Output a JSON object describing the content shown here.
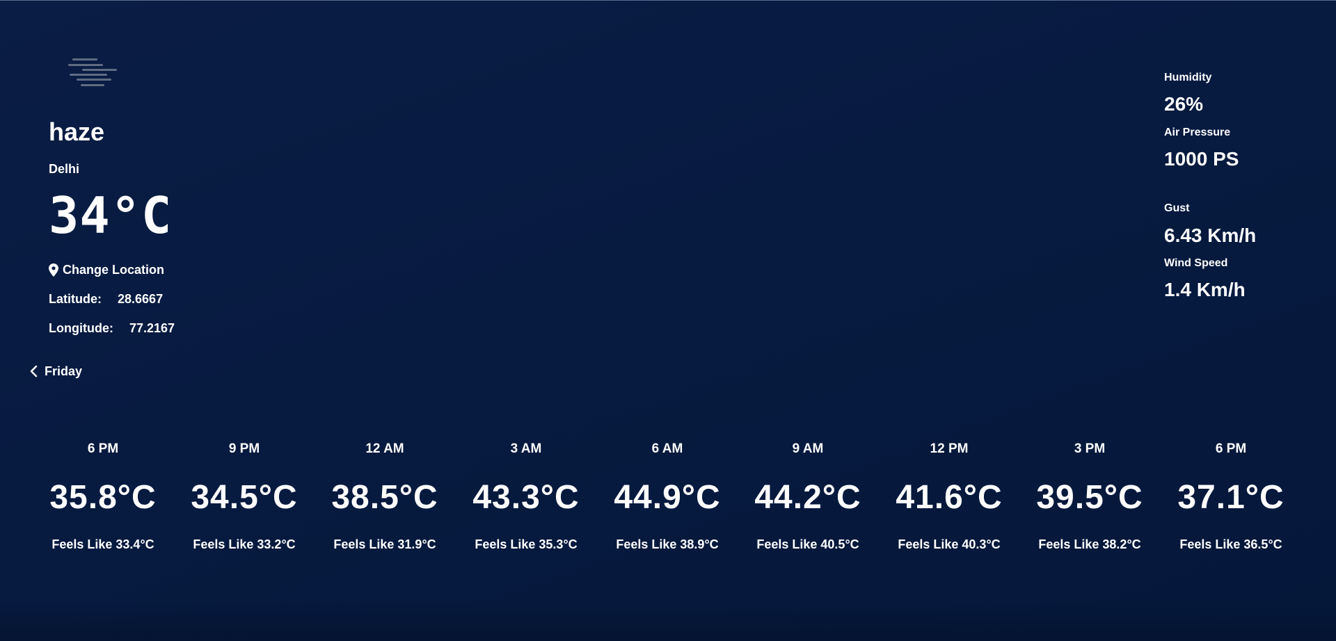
{
  "current": {
    "condition": "haze",
    "city": "Delhi",
    "temperature": "34°C",
    "change_location_label": "Change Location",
    "latitude_label": "Latitude:",
    "latitude_value": "28.6667",
    "longitude_label": "Longitude:",
    "longitude_value": "77.2167",
    "icon": "haze-icon"
  },
  "day_nav": {
    "label": "Friday",
    "icon": "chevron-left-icon"
  },
  "stats": {
    "humidity_label": "Humidity",
    "humidity_value": "26%",
    "pressure_label": "Air Pressure",
    "pressure_value": "1000 PS",
    "gust_label": "Gust",
    "gust_value": "6.43 Km/h",
    "wind_label": "Wind Speed",
    "wind_value": "1.4 Km/h"
  },
  "forecast": [
    {
      "time": "6 PM",
      "temp": "35.8°C",
      "feels": "Feels Like 33.4°C"
    },
    {
      "time": "9 PM",
      "temp": "34.5°C",
      "feels": "Feels Like 33.2°C"
    },
    {
      "time": "12 AM",
      "temp": "38.5°C",
      "feels": "Feels Like 31.9°C"
    },
    {
      "time": "3 AM",
      "temp": "43.3°C",
      "feels": "Feels Like 35.3°C"
    },
    {
      "time": "6 AM",
      "temp": "44.9°C",
      "feels": "Feels Like 38.9°C"
    },
    {
      "time": "9 AM",
      "temp": "44.2°C",
      "feels": "Feels Like 40.5°C"
    },
    {
      "time": "12 PM",
      "temp": "41.6°C",
      "feels": "Feels Like 40.3°C"
    },
    {
      "time": "3 PM",
      "temp": "39.5°C",
      "feels": "Feels Like 38.2°C"
    },
    {
      "time": "6 PM",
      "temp": "37.1°C",
      "feels": "Feels Like 36.5°C"
    }
  ],
  "colors": {
    "background": "#061838",
    "text": "#ffffff",
    "icon_gray": "#6f7a8c"
  }
}
